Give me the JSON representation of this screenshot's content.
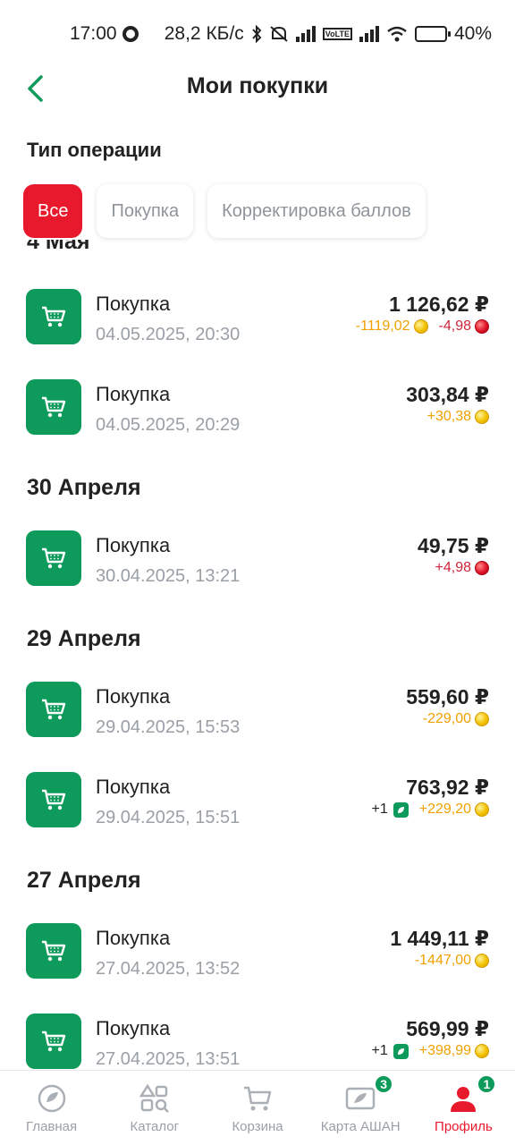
{
  "status_bar": {
    "time": "17:00",
    "speed": "28,2 КБ/с",
    "volte": "VoLTE",
    "battery": "40%",
    "battery_level": 0.4
  },
  "header": {
    "title": "Мои покупки",
    "back_icon": "chevron-left-icon"
  },
  "filters": {
    "label": "Тип операции",
    "chips": [
      "Все",
      "Покупка",
      "Корректировка баллов"
    ],
    "active_chip": "Все"
  },
  "groups": [
    {
      "date": "4 Мая",
      "items": [
        {
          "title": "Покупка",
          "datetime": "04.05.2025, 20:30",
          "amount": "1 126,62 ₽",
          "points": [
            {
              "text": "-1119,02",
              "color": "orange",
              "icon": "coin-gold"
            },
            {
              "text": "-4,98",
              "color": "red",
              "icon": "coin-red"
            }
          ]
        },
        {
          "title": "Покупка",
          "datetime": "04.05.2025, 20:29",
          "amount": "303,84 ₽",
          "points": [
            {
              "text": "+30,38",
              "color": "orange",
              "icon": "coin-gold"
            }
          ]
        }
      ]
    },
    {
      "date": "30 Апреля",
      "items": [
        {
          "title": "Покупка",
          "datetime": "30.04.2025, 13:21",
          "amount": "49,75 ₽",
          "points": [
            {
              "text": "+4,98",
              "color": "red",
              "icon": "coin-red"
            }
          ]
        }
      ]
    },
    {
      "date": "29 Апреля",
      "items": [
        {
          "title": "Покупка",
          "datetime": "29.04.2025, 15:53",
          "amount": "559,60 ₽",
          "points": [
            {
              "text": "-229,00",
              "color": "orange",
              "icon": "coin-gold"
            }
          ]
        },
        {
          "title": "Покупка",
          "datetime": "29.04.2025, 15:51",
          "amount": "763,92 ₽",
          "points": [
            {
              "text": "+1",
              "color": "dark",
              "icon": "leaf"
            },
            {
              "text": "+229,20",
              "color": "orange",
              "icon": "coin-gold"
            }
          ]
        }
      ]
    },
    {
      "date": "27 Апреля",
      "items": [
        {
          "title": "Покупка",
          "datetime": "27.04.2025, 13:52",
          "amount": "1 449,11 ₽",
          "points": [
            {
              "text": "-1447,00",
              "color": "orange",
              "icon": "coin-gold"
            }
          ]
        },
        {
          "title": "Покупка",
          "datetime": "27.04.2025, 13:51",
          "amount": "569,99 ₽",
          "points": [
            {
              "text": "+1",
              "color": "dark",
              "icon": "leaf"
            },
            {
              "text": "+398,99",
              "color": "orange",
              "icon": "coin-gold"
            }
          ]
        }
      ]
    }
  ],
  "bottom_nav": [
    {
      "label": "Главная",
      "icon": "home-icon",
      "badge": null,
      "active": false
    },
    {
      "label": "Каталог",
      "icon": "catalog-icon",
      "badge": null,
      "active": false
    },
    {
      "label": "Корзина",
      "icon": "cart-icon",
      "badge": null,
      "active": false
    },
    {
      "label": "Карта АШАН",
      "icon": "loyalty-card-icon",
      "badge": "3",
      "active": false
    },
    {
      "label": "Профиль",
      "icon": "profile-icon",
      "badge": "1",
      "active": true
    }
  ],
  "colors": {
    "accent_red": "#e8192c",
    "brand_green": "#0e9a5a",
    "points_orange": "#f0a000",
    "points_red": "#d0243a"
  }
}
